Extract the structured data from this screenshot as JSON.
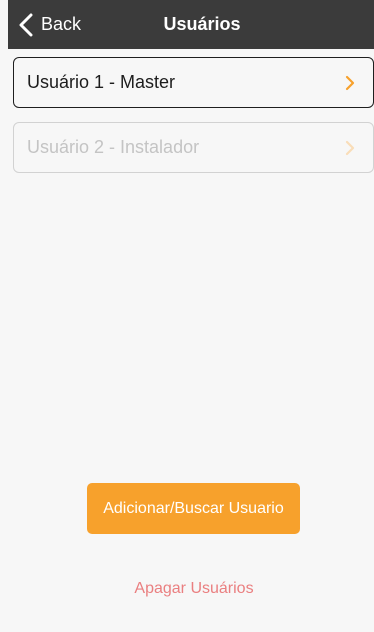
{
  "navbar": {
    "back_label": "Back",
    "title": "Usuários",
    "back_icon": "chevron-left-icon"
  },
  "users": [
    {
      "label": "Usuário 1 - Master",
      "state": "active"
    },
    {
      "label": "Usuário 2 - Instalador",
      "state": "disabled"
    }
  ],
  "actions": {
    "add_label": "Adicionar/Buscar Usuario",
    "delete_label": "Apagar Usuários"
  },
  "colors": {
    "navbar_bg": "#3b3b3b",
    "accent": "#f7a12c",
    "danger": "#ea7f80",
    "disabled_text": "#c4c4c4"
  }
}
